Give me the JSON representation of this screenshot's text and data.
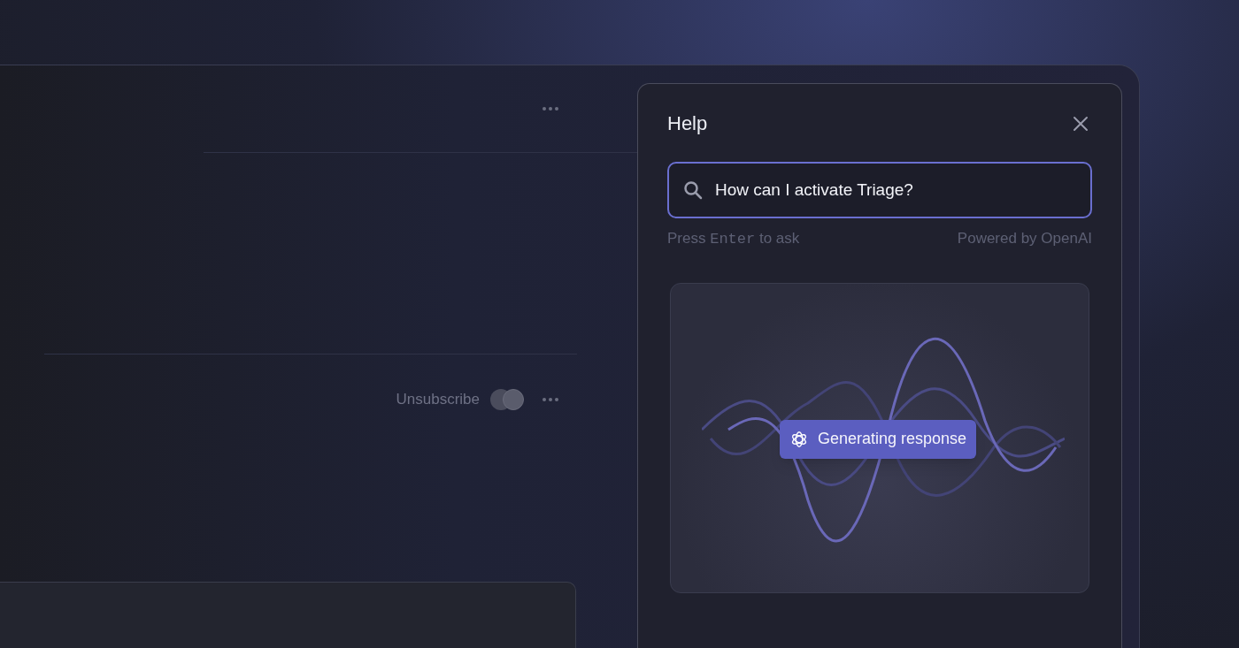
{
  "main": {
    "row": {
      "action": "Unsubscribe"
    }
  },
  "help": {
    "title": "Help",
    "search": {
      "value": "How can I activate Triage?"
    },
    "hint": {
      "before": "Press",
      "key": "Enter",
      "after": "to ask"
    },
    "credit": "Powered by OpenAI",
    "status": {
      "label": "Generating response"
    }
  }
}
